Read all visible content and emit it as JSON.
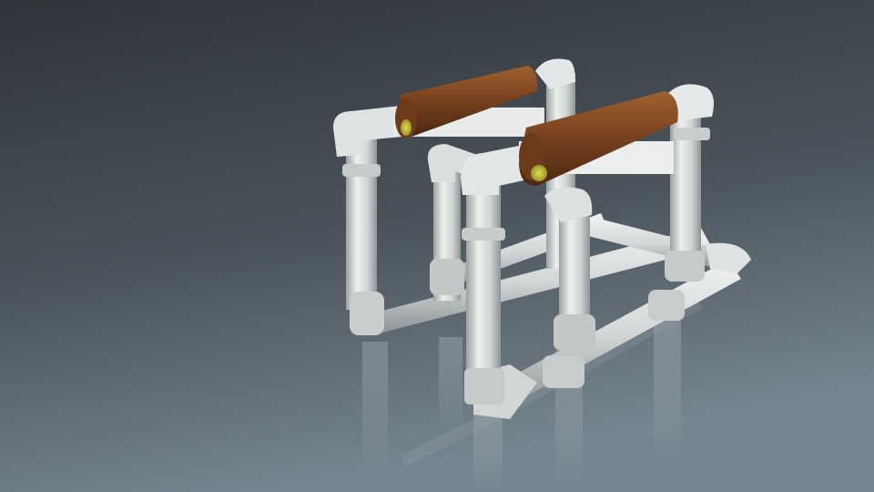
{
  "scene": {
    "subject": "pvc-pipe-parallettes-with-wooden-handles",
    "colors": {
      "background_top": "#34393f",
      "background_bottom": "#6e7d87",
      "pipe_light": "#e6e8e8",
      "pipe_mid": "#c9cdcd",
      "pipe_dark": "#8c9293",
      "wood_light": "#9a5a2c",
      "wood_mid": "#7a4320",
      "wood_dark": "#4e2a12",
      "inner_core": "#c9c43a"
    }
  }
}
